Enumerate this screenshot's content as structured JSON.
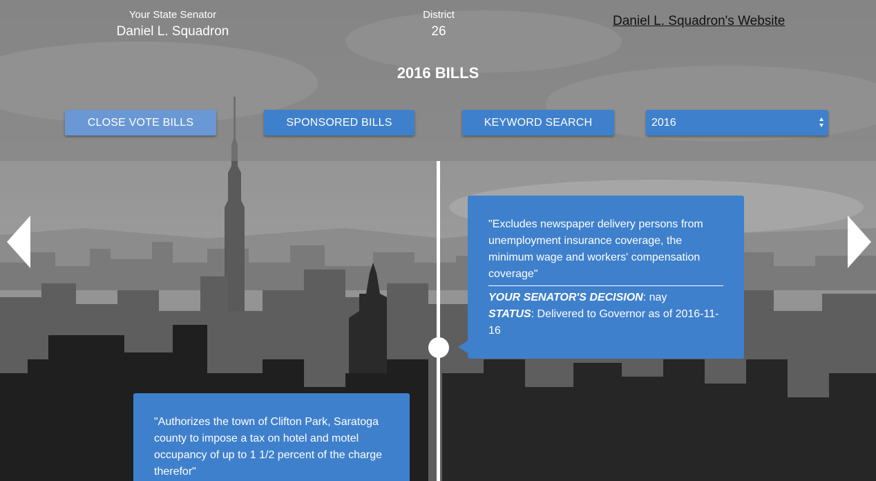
{
  "header": {
    "senator_label": "Your State Senator",
    "senator_name": "Daniel L. Squadron",
    "district_label": "District",
    "district_number": "26",
    "website_link": "Daniel L. Squadron's Website",
    "page_title": "2016 BILLS"
  },
  "toolbar": {
    "close_vote_label": "CLOSE VOTE BILLS",
    "sponsored_label": "SPONSORED BILLS",
    "keyword_search_label": "KEYWORD SEARCH",
    "year_selected": "2016"
  },
  "bills": [
    {
      "description": "\"Excludes newspaper delivery persons from unemployment insurance coverage, the minimum wage and workers' compensation coverage\"",
      "decision_label": "YOUR SENATOR'S DECISION",
      "decision_value": ": nay",
      "status_label": "STATUS",
      "status_value": ": Delivered to Governor as of 2016-11-16"
    },
    {
      "description": "\"Authorizes the town of Clifton Park, Saratoga county to impose a tax on hotel and motel occupancy of up to 1 1/2 percent of the charge therefor\""
    }
  ],
  "icons": {
    "prev": "chevron-left-icon",
    "next": "chevron-right-icon",
    "select_arrows": "updown-arrows-icon"
  },
  "colors": {
    "accent": "#3f80cc",
    "accent_faded": "#6a98d4"
  }
}
